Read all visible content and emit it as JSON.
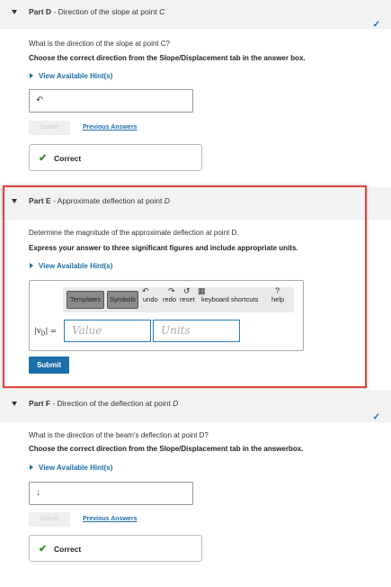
{
  "part_d": {
    "label": "Part D",
    "title": " - Direction of the slope at point ",
    "point": "C",
    "question": "What is the direction of the slope at point C?",
    "instruction": "Choose the correct direction from the Slope/Displacement tab in the answer box.",
    "hint": "View Available Hint(s)",
    "answer_value": "↶",
    "submit": "Submit",
    "previous_answers": "Previous Answers",
    "correct": "Correct"
  },
  "part_e": {
    "label": "Part E",
    "title": " - Approximate deflection at point ",
    "point": "D",
    "question": "Determine the magnitude of the approximate deflection at point D.",
    "instruction": "Express your answer to three significant figures and include appropriate units.",
    "hint": "View Available Hint(s)",
    "toolbar": {
      "templates": "Templates",
      "symbols": "Symbols",
      "undo": "undo",
      "redo": "redo",
      "reset": "reset",
      "keyboard_shortcuts": "keyboard shortcuts",
      "help": "help"
    },
    "variable_label": "|v",
    "variable_sub": "D",
    "variable_suffix": "| =",
    "value_placeholder": "Value",
    "units_placeholder": "Units",
    "submit": "Submit"
  },
  "part_f": {
    "label": "Part F",
    "title": " - Direction of the deflection at point ",
    "point": "D",
    "question": "What is the direction of the beam's deflection at point D?",
    "instruction": "Choose the correct direction from the Slope/Displacement tab in the answerbox.",
    "hint": "View Available Hint(s)",
    "answer_value": "↓",
    "submit": "Submit",
    "previous_answers": "Previous Answers",
    "correct": "Correct"
  },
  "colors": {
    "accent": "#1c6ea8",
    "highlight": "#e0443e",
    "correct": "#3a8a2e"
  }
}
